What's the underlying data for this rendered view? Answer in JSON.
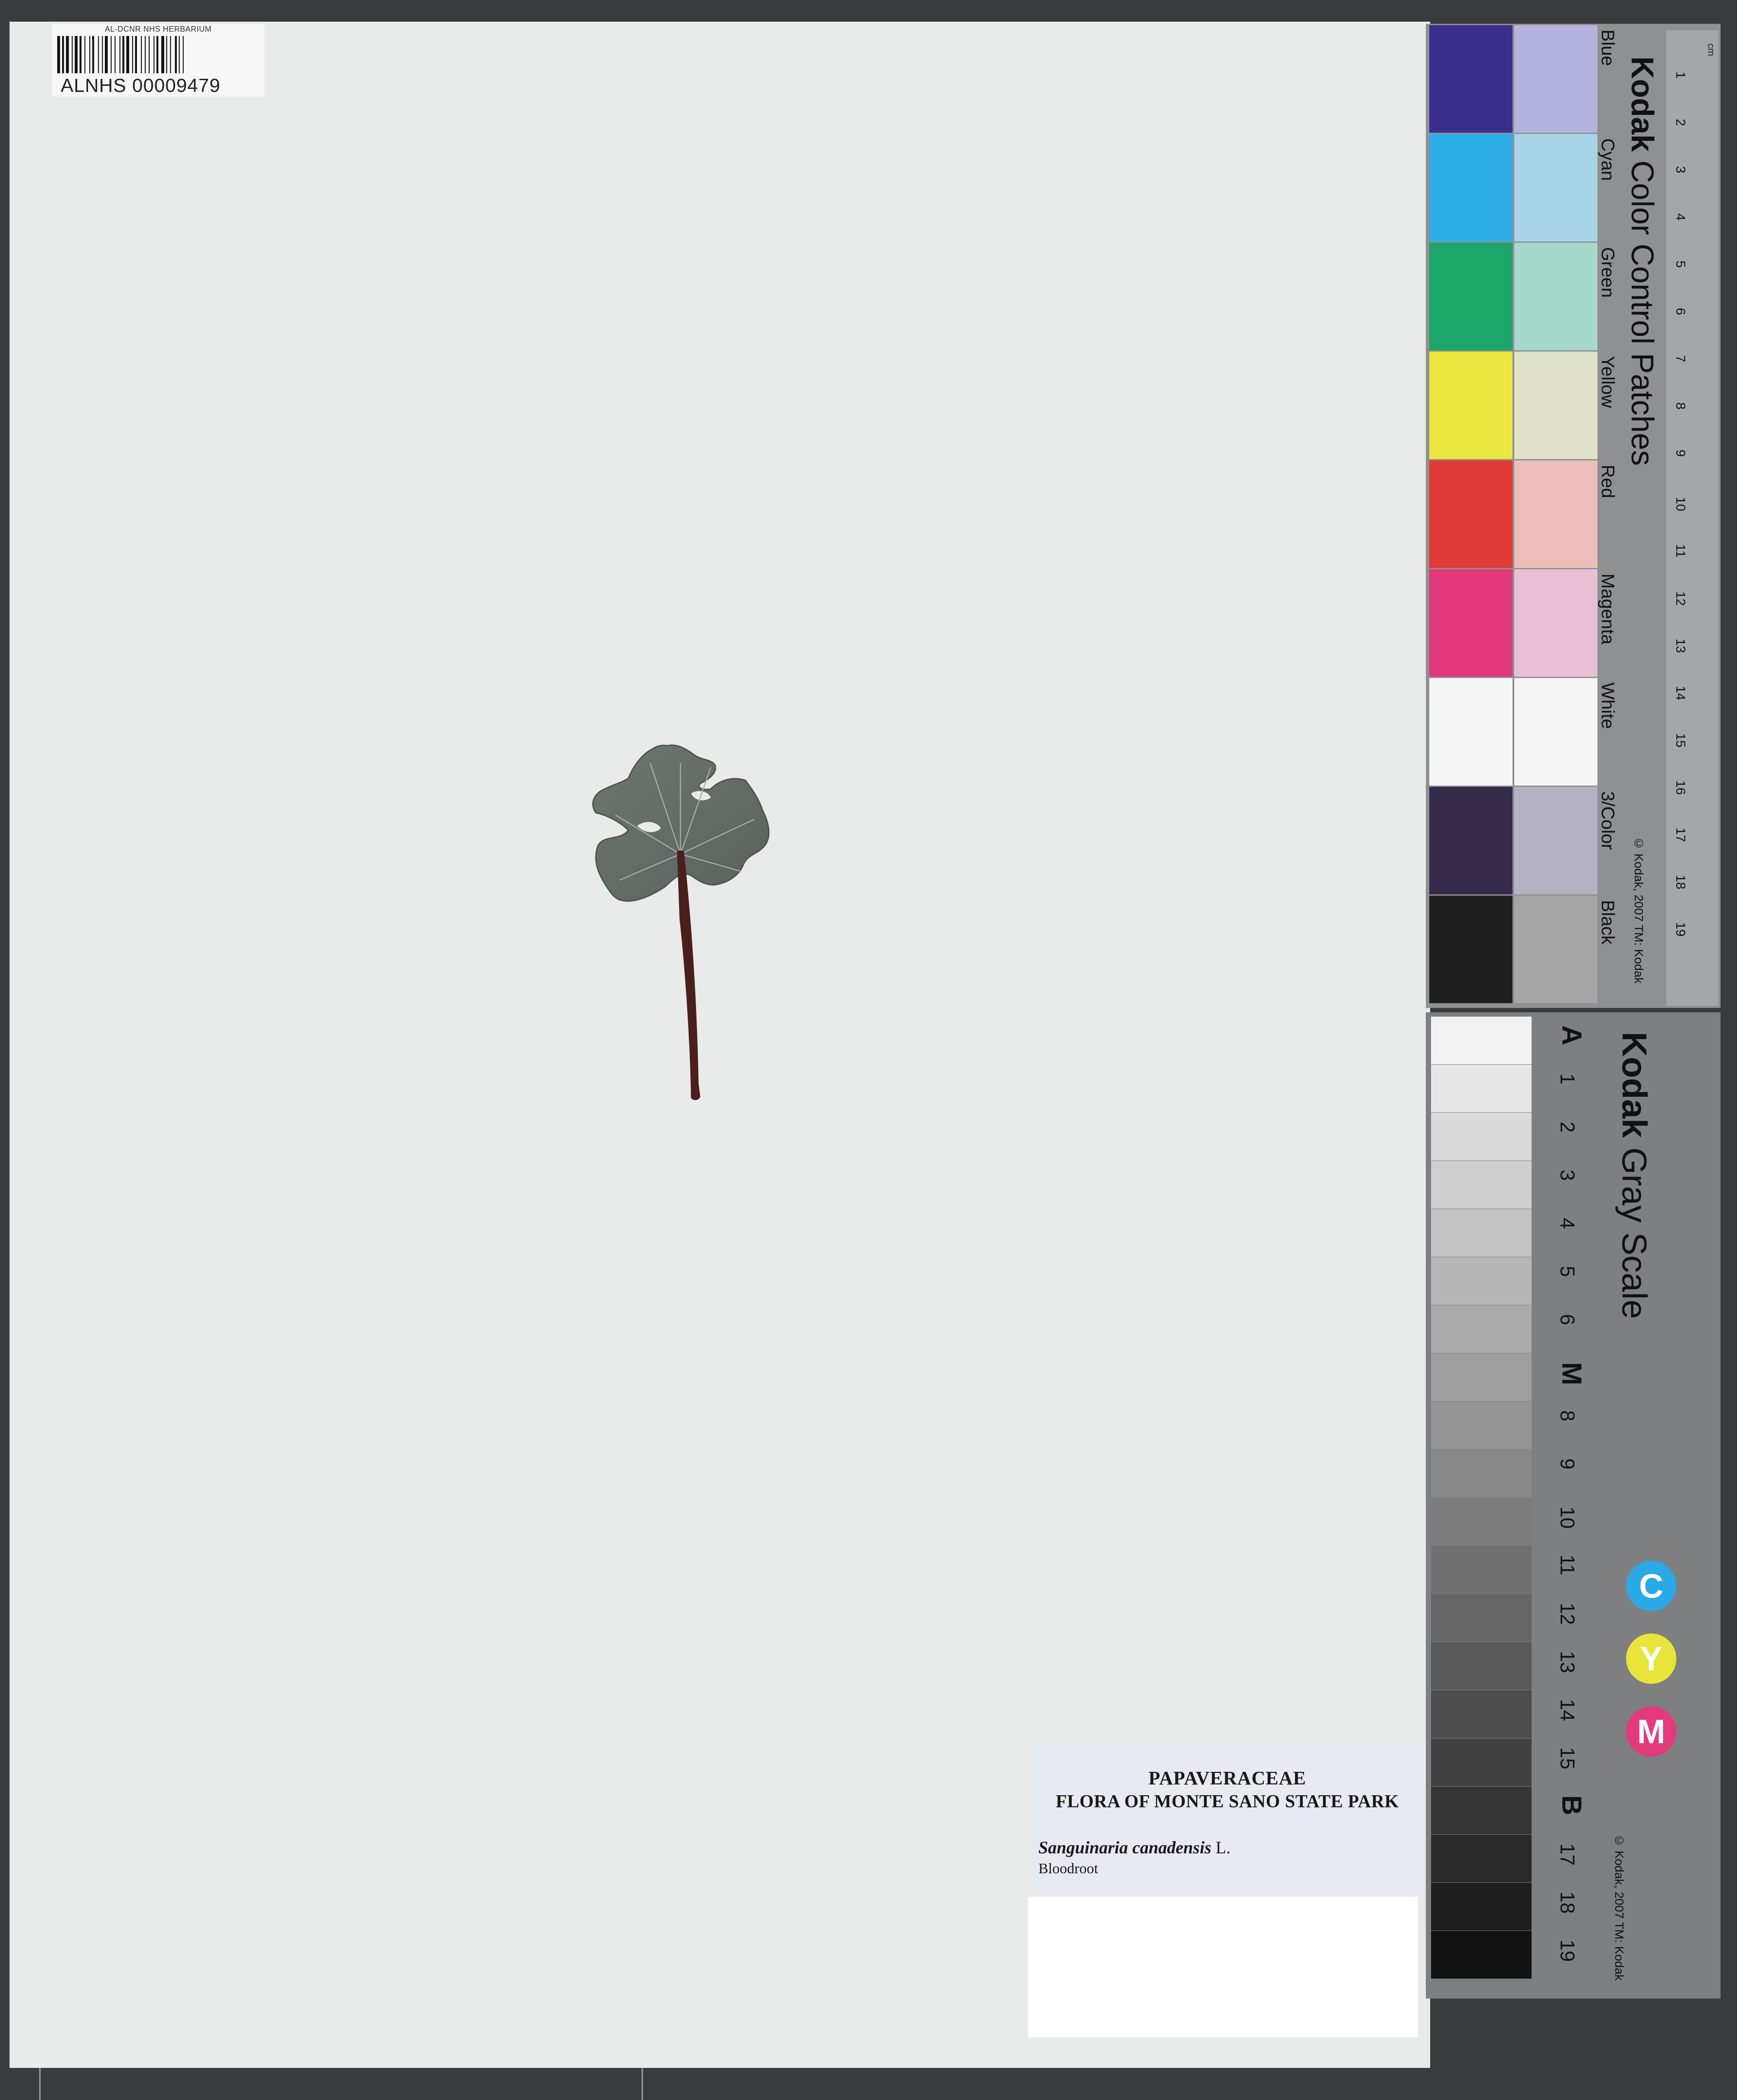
{
  "barcode_label": {
    "header": "AL-DCNR NHS HERBARIUM",
    "catalog_number": "ALNHS 00009479"
  },
  "specimen_label": {
    "family": "PAPAVERACEAE",
    "flora": "FLORA OF MONTE SANO STATE PARK",
    "species": "Sanguinaria canadensis",
    "author": "L.",
    "common_name": "Bloodroot"
  },
  "color_card": {
    "brand": "Kodak",
    "title": "Color Control Patches",
    "copyright": "© Kodak, 2007 TM: Kodak",
    "unit": "cm",
    "patches": [
      {
        "name": "Blue",
        "dark": "#3a2f8e",
        "light": "#b3b3de"
      },
      {
        "name": "Cyan",
        "dark": "#2eaee6",
        "light": "#a9d4e8"
      },
      {
        "name": "Green",
        "dark": "#1ca669",
        "light": "#a6d9cb"
      },
      {
        "name": "Yellow",
        "dark": "#ece73e",
        "light": "#dfe2c8"
      },
      {
        "name": "Red",
        "dark": "#e23a36",
        "light": "#ecbfba"
      },
      {
        "name": "Magenta",
        "dark": "#e2397a",
        "light": "#e9bfd4"
      },
      {
        "name": "White",
        "dark": "#f4f5f4",
        "light": "#f4f5f4"
      },
      {
        "name": "3/Color",
        "dark": "#362a4a",
        "light": "#b4b2c2"
      },
      {
        "name": "Black",
        "dark": "#1f1f1f",
        "light": "#a6a6a6"
      }
    ],
    "ruler_numbers": [
      "1",
      "2",
      "3",
      "4",
      "5",
      "6",
      "7",
      "8",
      "9",
      "10",
      "11",
      "12",
      "13",
      "14",
      "15",
      "16",
      "17",
      "18",
      "19"
    ]
  },
  "gray_card": {
    "brand": "Kodak",
    "title": "Gray Scale",
    "copyright": "© Kodak, 2007 TM: Kodak",
    "steps": [
      "A",
      "1",
      "2",
      "3",
      "4",
      "5",
      "6",
      "M",
      "8",
      "9",
      "10",
      "11",
      "12",
      "13",
      "14",
      "15",
      "B",
      "17",
      "18",
      "19"
    ],
    "cym": [
      {
        "letter": "C",
        "color": "#2aa9e4"
      },
      {
        "letter": "Y",
        "color": "#e9e43a"
      },
      {
        "letter": "M",
        "color": "#e23a7c"
      }
    ]
  }
}
